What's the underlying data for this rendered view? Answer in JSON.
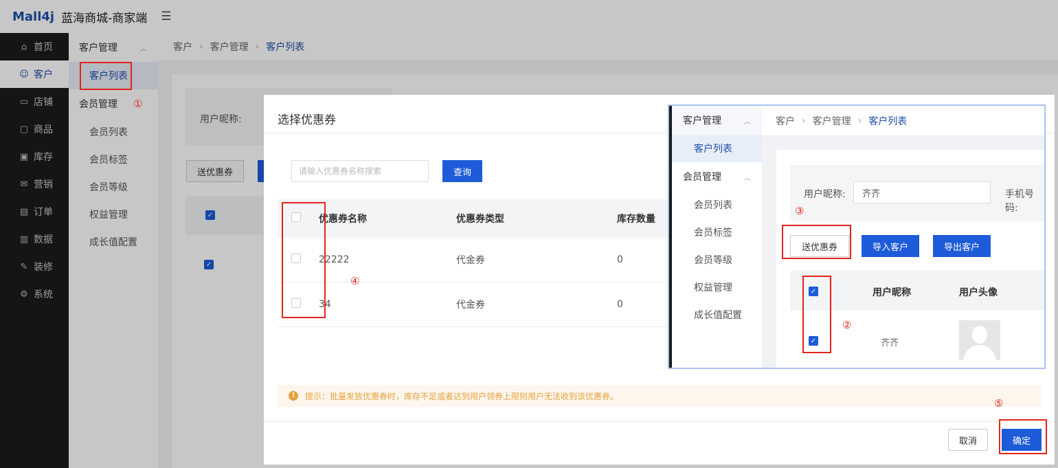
{
  "header": {
    "logo": "Mall4j",
    "brand": "蓝海商城-商家端",
    "menu_icon": "menu-fold-icon"
  },
  "main_menu": [
    {
      "label": "首页",
      "icon": "home-icon"
    },
    {
      "label": "客户",
      "icon": "user-icon"
    },
    {
      "label": "店铺",
      "icon": "shop-icon"
    },
    {
      "label": "商品",
      "icon": "goods-icon"
    },
    {
      "label": "库存",
      "icon": "inventory-icon"
    },
    {
      "label": "营销",
      "icon": "gift-icon"
    },
    {
      "label": "订单",
      "icon": "order-icon"
    },
    {
      "label": "数据",
      "icon": "chart-icon"
    },
    {
      "label": "装修",
      "icon": "decorate-icon"
    },
    {
      "label": "系统",
      "icon": "settings-icon"
    }
  ],
  "sub_menu": {
    "group1": "客户管理",
    "item1": "客户列表",
    "group2": "会员管理",
    "items": [
      "会员列表",
      "会员标签",
      "会员等级",
      "权益管理",
      "成长值配置"
    ]
  },
  "breadcrumb": [
    "客户",
    "客户管理",
    "客户列表"
  ],
  "bg": {
    "label": "用户昵称:",
    "send_btn": "送优惠券"
  },
  "dialog": {
    "title": "选择优惠券",
    "search_placeholder": "请输入优惠券名称搜索",
    "query_btn": "查询",
    "columns": [
      "优惠券名称",
      "优惠券类型",
      "库存数量"
    ],
    "rows": [
      {
        "name": "22222",
        "type": "代金券",
        "stock": "0"
      },
      {
        "name": "34",
        "type": "代金券",
        "stock": "0"
      }
    ],
    "tip": "提示：批量发放优惠券时，库存不足或者达到用户领券上限则用户无法收到该优惠券。",
    "cancel": "取消",
    "confirm": "确定"
  },
  "inset": {
    "menu": {
      "group1": "客户管理",
      "item1": "客户列表",
      "group2": "会员管理",
      "items": [
        "会员列表",
        "会员标签",
        "会员等级",
        "权益管理",
        "成长值配置"
      ]
    },
    "breadcrumb": [
      "客户",
      "客户管理",
      "客户列表"
    ],
    "nickname_label": "用户昵称:",
    "nickname_value": "齐齐",
    "phone_label": "手机号码:",
    "buttons": [
      "送优惠券",
      "导入客户",
      "导出客户"
    ],
    "columns": [
      "用户昵称",
      "用户头像"
    ],
    "row_nickname": "齐齐"
  },
  "markers": [
    "①",
    "②",
    "③",
    "④",
    "⑤"
  ],
  "colors": {
    "accent": "#1d5bd8",
    "annotation": "#e2231a",
    "sidebar": "#1b1b1b"
  }
}
